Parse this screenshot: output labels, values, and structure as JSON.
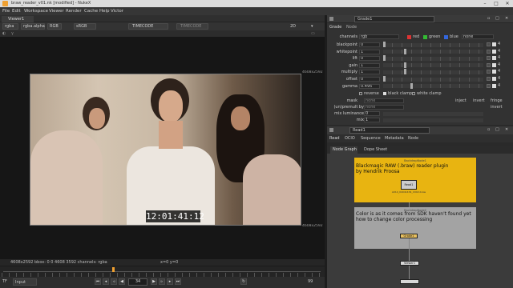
{
  "window": {
    "title": "braw_reader_v01.nk [modified] - NukeX",
    "min_icon": "minimize-icon",
    "max_icon": "maximize-icon",
    "close_icon": "close-icon"
  },
  "menubar": [
    "File",
    "Edit",
    "Workspace",
    "Viewer",
    "Render",
    "Cache",
    "Help",
    "Victor"
  ],
  "viewer": {
    "tab_label": "Viewer1",
    "channels": "rgba",
    "alpha": "rgba.alpha",
    "colorspace": "RGB",
    "lut": "sRGB",
    "overlay_a": "TIMECODE",
    "overlay_b": "TIMECODE",
    "zoom": "2D",
    "resolution_top_right": "4608x2592",
    "resolution_bottom_right": "4608x2592",
    "timecode": "12:01:41:12",
    "status": "4608x2592  bbox: 0 0 4608 3592 channels: rgba",
    "coords": "x=0 y=0",
    "frame": "34",
    "fps_label": "TF",
    "input_label": "Input",
    "end_frame": "99"
  },
  "grade": {
    "node_name": "Grade1",
    "tabs": [
      "Grade",
      "Node"
    ],
    "channels_label": "channels",
    "channels_value": "rgb",
    "channel_toggles": [
      "red",
      "green",
      "blue"
    ],
    "channel_extra": "none",
    "rows": [
      {
        "label": "blackpoint",
        "value": "0"
      },
      {
        "label": "whitepoint",
        "value": "1"
      },
      {
        "label": "lift",
        "value": "0"
      },
      {
        "label": "gain",
        "value": "1"
      },
      {
        "label": "multiply",
        "value": "1"
      },
      {
        "label": "offset",
        "value": "0"
      },
      {
        "label": "gamma",
        "value": "0.495"
      }
    ],
    "checks": [
      "reverse",
      "black clamp",
      "white clamp"
    ],
    "mask_label": "mask",
    "mask_value": "none",
    "mask_options": [
      "inject",
      "invert",
      "fringe"
    ],
    "unpremult_label": "(un)premult by",
    "unpremult_value": "none",
    "unpremult_option": "invert",
    "mixlum_label": "mix luminance",
    "mixlum_value": "0",
    "mix_label": "mix",
    "mix_value": "1"
  },
  "read": {
    "node_name": "Read1",
    "tabs": [
      "Read",
      "OCIO",
      "Sequence",
      "Metadata",
      "Node"
    ]
  },
  "nodegraph": {
    "tabs": [
      "Node Graph",
      "Dope Sheet"
    ],
    "backdrop1_title": "BackdropNode1",
    "backdrop1_text": "Blackmagic RAW (.braw) reader plugin by Hendrik Proosa",
    "read_node_label": "Read1",
    "read_node_sub": "A014_04041434_C002.braw",
    "backdrop2_title": "BackdropNode2",
    "backdrop2_text": "Color is as it comes from SDK haven't found yet how to change color processing",
    "grade_node_label": "Grade1",
    "viewer_node_label": "Viewer1"
  },
  "colors": {
    "backdrop1": "#e8b411",
    "backdrop2": "#a3a3a3",
    "accent": "#f0a030"
  }
}
